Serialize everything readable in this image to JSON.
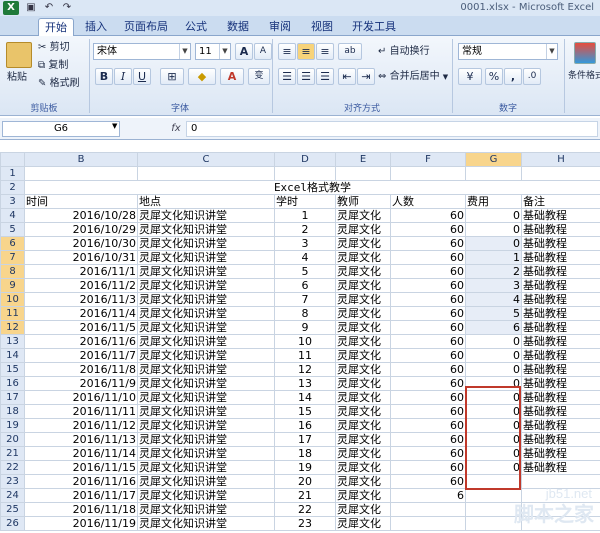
{
  "window": {
    "title": "0001.xlsx - Microsoft Excel",
    "app_icon": "X"
  },
  "quick_access": {
    "save_icon": "save-icon",
    "undo_icon": "undo-icon",
    "redo_icon": "redo-icon"
  },
  "tabs": [
    "开始",
    "插入",
    "页面布局",
    "公式",
    "数据",
    "审阅",
    "视图",
    "开发工具"
  ],
  "ribbon": {
    "clipboard": {
      "paste": "粘贴",
      "cut": "剪切",
      "copy": "复制",
      "format_painter": "格式刷",
      "label": "剪贴板"
    },
    "font": {
      "font_name": "宋体",
      "font_size": "11",
      "bold": "B",
      "italic": "I",
      "underline": "U",
      "grow": "A",
      "shrink": "A",
      "color_letter": "A",
      "wen": "变",
      "label": "字体"
    },
    "alignment": {
      "wrap": "自动换行",
      "merge": "合并后居中",
      "orient": "ab",
      "label": "对齐方式"
    },
    "number": {
      "format": "常规",
      "percent": "%",
      "comma": ",",
      "inc_dec": ".0",
      "label": "数字"
    },
    "styles": {
      "conditional": "条件格式"
    }
  },
  "formula_bar": {
    "name_box": "G6",
    "fx": "fx",
    "value": "0"
  },
  "columns": [
    "",
    "B",
    "C",
    "D",
    "E",
    "F",
    "G",
    "H"
  ],
  "selected_column": "G",
  "rows": [
    {
      "n": "1",
      "b": "",
      "c": "",
      "d": "",
      "e": "",
      "f": "",
      "g": "",
      "h": ""
    },
    {
      "n": "2",
      "b": "",
      "c": "",
      "d": "",
      "e": "",
      "f": "",
      "g": "",
      "h": ""
    },
    {
      "n": "3",
      "b": "时间",
      "c": "地点",
      "d": "学时",
      "e": "教师",
      "f": "人数",
      "g": "费用",
      "h": "备注"
    },
    {
      "n": "4",
      "b": "2016/10/28",
      "c": "灵犀文化知识讲堂",
      "d": "1",
      "e": "灵犀文化",
      "f": "60",
      "g": "0",
      "h": "基础教程"
    },
    {
      "n": "5",
      "b": "2016/10/29",
      "c": "灵犀文化知识讲堂",
      "d": "2",
      "e": "灵犀文化",
      "f": "60",
      "g": "0",
      "h": "基础教程"
    },
    {
      "n": "6",
      "b": "2016/10/30",
      "c": "灵犀文化知识讲堂",
      "d": "3",
      "e": "灵犀文化",
      "f": "60",
      "g": "0",
      "h": "基础教程"
    },
    {
      "n": "7",
      "b": "2016/10/31",
      "c": "灵犀文化知识讲堂",
      "d": "4",
      "e": "灵犀文化",
      "f": "60",
      "g": "1",
      "h": "基础教程"
    },
    {
      "n": "8",
      "b": "2016/11/1",
      "c": "灵犀文化知识讲堂",
      "d": "5",
      "e": "灵犀文化",
      "f": "60",
      "g": "2",
      "h": "基础教程"
    },
    {
      "n": "9",
      "b": "2016/11/2",
      "c": "灵犀文化知识讲堂",
      "d": "6",
      "e": "灵犀文化",
      "f": "60",
      "g": "3",
      "h": "基础教程"
    },
    {
      "n": "10",
      "b": "2016/11/3",
      "c": "灵犀文化知识讲堂",
      "d": "7",
      "e": "灵犀文化",
      "f": "60",
      "g": "4",
      "h": "基础教程"
    },
    {
      "n": "11",
      "b": "2016/11/4",
      "c": "灵犀文化知识讲堂",
      "d": "8",
      "e": "灵犀文化",
      "f": "60",
      "g": "5",
      "h": "基础教程"
    },
    {
      "n": "12",
      "b": "2016/11/5",
      "c": "灵犀文化知识讲堂",
      "d": "9",
      "e": "灵犀文化",
      "f": "60",
      "g": "6",
      "h": "基础教程"
    },
    {
      "n": "13",
      "b": "2016/11/6",
      "c": "灵犀文化知识讲堂",
      "d": "10",
      "e": "灵犀文化",
      "f": "60",
      "g": "0",
      "h": "基础教程"
    },
    {
      "n": "14",
      "b": "2016/11/7",
      "c": "灵犀文化知识讲堂",
      "d": "11",
      "e": "灵犀文化",
      "f": "60",
      "g": "0",
      "h": "基础教程"
    },
    {
      "n": "15",
      "b": "2016/11/8",
      "c": "灵犀文化知识讲堂",
      "d": "12",
      "e": "灵犀文化",
      "f": "60",
      "g": "0",
      "h": "基础教程"
    },
    {
      "n": "16",
      "b": "2016/11/9",
      "c": "灵犀文化知识讲堂",
      "d": "13",
      "e": "灵犀文化",
      "f": "60",
      "g": "0",
      "h": "基础教程"
    },
    {
      "n": "17",
      "b": "2016/11/10",
      "c": "灵犀文化知识讲堂",
      "d": "14",
      "e": "灵犀文化",
      "f": "60",
      "g": "0",
      "h": "基础教程"
    },
    {
      "n": "18",
      "b": "2016/11/11",
      "c": "灵犀文化知识讲堂",
      "d": "15",
      "e": "灵犀文化",
      "f": "60",
      "g": "0",
      "h": "基础教程"
    },
    {
      "n": "19",
      "b": "2016/11/12",
      "c": "灵犀文化知识讲堂",
      "d": "16",
      "e": "灵犀文化",
      "f": "60",
      "g": "0",
      "h": "基础教程"
    },
    {
      "n": "20",
      "b": "2016/11/13",
      "c": "灵犀文化知识讲堂",
      "d": "17",
      "e": "灵犀文化",
      "f": "60",
      "g": "0",
      "h": "基础教程"
    },
    {
      "n": "21",
      "b": "2016/11/14",
      "c": "灵犀文化知识讲堂",
      "d": "18",
      "e": "灵犀文化",
      "f": "60",
      "g": "0",
      "h": "基础教程"
    },
    {
      "n": "22",
      "b": "2016/11/15",
      "c": "灵犀文化知识讲堂",
      "d": "19",
      "e": "灵犀文化",
      "f": "60",
      "g": "0",
      "h": "基础教程"
    },
    {
      "n": "23",
      "b": "2016/11/16",
      "c": "灵犀文化知识讲堂",
      "d": "20",
      "e": "灵犀文化",
      "f": "60",
      "g": "",
      "h": ""
    },
    {
      "n": "24",
      "b": "2016/11/17",
      "c": "灵犀文化知识讲堂",
      "d": "21",
      "e": "灵犀文化",
      "f": "6",
      "g": "",
      "h": ""
    },
    {
      "n": "25",
      "b": "2016/11/18",
      "c": "灵犀文化知识讲堂",
      "d": "22",
      "e": "灵犀文化",
      "f": "",
      "g": "",
      "h": ""
    },
    {
      "n": "26",
      "b": "2016/11/19",
      "c": "灵犀文化知识讲堂",
      "d": "23",
      "e": "灵犀文化",
      "f": "",
      "g": "",
      "h": ""
    }
  ],
  "sheet_title": "Excel格式教学",
  "watermark": {
    "site": "jb51.net",
    "brand": "脚本之家"
  },
  "colors": {
    "selection_border": "#c0392b",
    "ribbon_blue": "#15317a"
  }
}
